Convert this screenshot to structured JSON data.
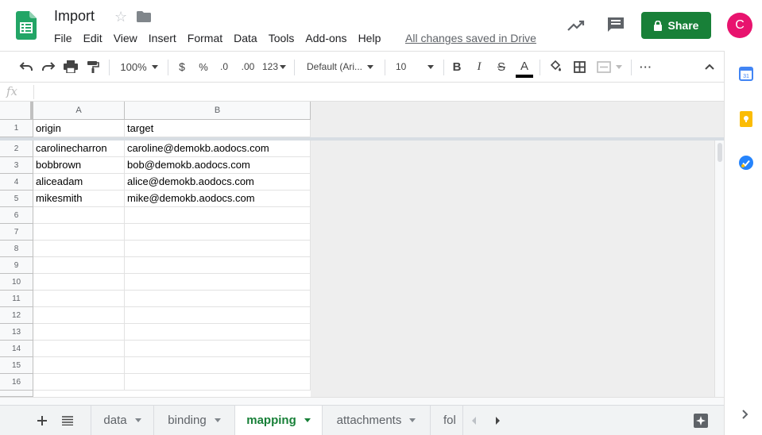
{
  "header": {
    "title": "Import",
    "save_status": "All changes saved in Drive",
    "share_label": "Share",
    "avatar_initial": "C",
    "menu": [
      "File",
      "Edit",
      "View",
      "Insert",
      "Format",
      "Data",
      "Tools",
      "Add-ons",
      "Help"
    ]
  },
  "toolbar": {
    "zoom": "100%",
    "currency": "$",
    "percent": "%",
    "decrease_decimal": ".0",
    "increase_decimal": ".00",
    "more_formats": "123",
    "font": "Default (Ari...",
    "font_size": "10",
    "bold": "B",
    "italic": "I",
    "strike": "S",
    "text_color": "A",
    "more": "···"
  },
  "formula_bar": {
    "fx": "fx",
    "value": ""
  },
  "grid": {
    "columns": [
      "A",
      "B"
    ],
    "row_numbers": [
      "1",
      "2",
      "3",
      "4",
      "5",
      "6",
      "7",
      "8",
      "9",
      "10",
      "11",
      "12",
      "13",
      "14",
      "15",
      "16"
    ],
    "rows": [
      [
        "origin",
        "target"
      ],
      [
        "carolinecharron",
        "caroline@demokb.aodocs.com"
      ],
      [
        "bobbrown",
        "bob@demokb.aodocs.com"
      ],
      [
        "aliceadam",
        "alice@demokb.aodocs.com"
      ],
      [
        "mikesmith",
        "mike@demokb.aodocs.com"
      ],
      [
        "",
        ""
      ],
      [
        "",
        ""
      ],
      [
        "",
        ""
      ],
      [
        "",
        ""
      ],
      [
        "",
        ""
      ],
      [
        "",
        ""
      ],
      [
        "",
        ""
      ],
      [
        "",
        ""
      ],
      [
        "",
        ""
      ],
      [
        "",
        ""
      ],
      [
        "",
        ""
      ]
    ]
  },
  "sheets": {
    "tabs": [
      {
        "label": "data",
        "active": false
      },
      {
        "label": "binding",
        "active": false
      },
      {
        "label": "mapping",
        "active": true
      },
      {
        "label": "attachments",
        "active": false
      },
      {
        "label": "fol",
        "active": false
      }
    ]
  },
  "colors": {
    "brand_green": "#188038",
    "avatar": "#e8136e"
  }
}
